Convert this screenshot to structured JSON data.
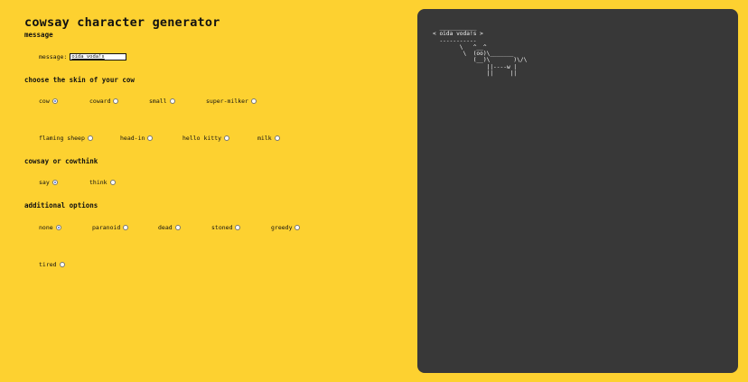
{
  "title": "cowsay character generator",
  "message_section": {
    "heading": "message",
    "label": "message:",
    "value": "oida voda!s"
  },
  "skin_section": {
    "heading": "choose the skin of your cow",
    "options": [
      {
        "label": "cow",
        "checked": true
      },
      {
        "label": "coward",
        "checked": false
      },
      {
        "label": "small",
        "checked": false
      },
      {
        "label": "super-milker",
        "checked": false
      },
      {
        "label": "flaming sheep",
        "checked": false
      },
      {
        "label": "head-in",
        "checked": false
      },
      {
        "label": "hello kitty",
        "checked": false
      },
      {
        "label": "milk",
        "checked": false
      }
    ]
  },
  "mode_section": {
    "heading": "cowsay or cowthink",
    "options": [
      {
        "label": "say",
        "checked": true
      },
      {
        "label": "think",
        "checked": false
      }
    ]
  },
  "extra_section": {
    "heading": "additional options",
    "options": [
      {
        "label": "none",
        "checked": true
      },
      {
        "label": "paranoid",
        "checked": false
      },
      {
        "label": "dead",
        "checked": false
      },
      {
        "label": "stoned",
        "checked": false
      },
      {
        "label": "greedy",
        "checked": false
      },
      {
        "label": "tired",
        "checked": false
      }
    ]
  },
  "output": {
    "ascii": "  ___________\n< oida voda!s >\n  -----------\n        \\   ^__^\n         \\  (oo)\\_______\n            (__)\\       )\\/\\\n                ||----w |\n                ||     ||"
  }
}
